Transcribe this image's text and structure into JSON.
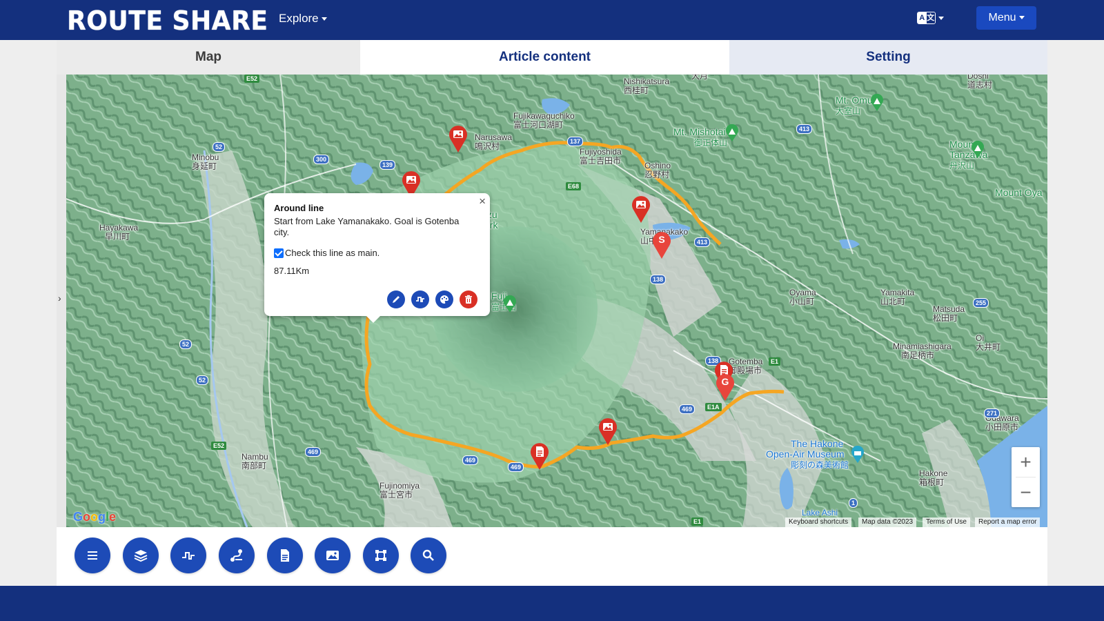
{
  "header": {
    "logo": "ROUTE SHARE",
    "explore_label": "Explore",
    "lang_a": "A",
    "lang_b": "文",
    "menu_label": "Menu"
  },
  "tabs": [
    {
      "label": "Map"
    },
    {
      "label": "Article content"
    },
    {
      "label": "Setting"
    }
  ],
  "popup": {
    "title": "Around line",
    "description": "Start from Lake Yamanakako. Goal is Gotenba city.",
    "checkbox_label": "Check this line as main.",
    "checked": true,
    "distance": "87.11Km",
    "close_label": "×"
  },
  "map": {
    "labels": {
      "nishikatsura": "Nishikatsura",
      "nishikatsura_jp": "西桂町",
      "otsuki_jp": "大月",
      "doshi": "Doshi",
      "doshi_jp": "道志村",
      "mt_omuro": "Mt. Omuro",
      "mt_omuro_jp": "大室山",
      "fujikawaguchiko": "Fujikawaguchiko",
      "fujikawaguchiko_jp": "富士河口湖町",
      "narusawa": "Narusawa",
      "narusawa_jp": "鳴沢村",
      "fujiyoshida": "Fujiyoshida",
      "fujiyoshida_jp": "富士吉田市",
      "oshino": "Oshino",
      "oshino_jp": "忍野村",
      "mt_mishotai": "Mt. Mishotai",
      "mt_mishotai_jp": "御正体山",
      "mount_tanzawa": "Mount",
      "mount_tanzawa2": "Tanzawa",
      "mount_tanzawa_jp": "丹沢山",
      "mount_oyama": "Mount Oya",
      "minobu": "Minobu",
      "minobu_jp": "身延町",
      "hayakawa": "Hayakawa",
      "hayakawa_jp": "早川町",
      "yamanakako": "Yamanakako",
      "yamanakako_jp": "山中",
      "izu": "Izu",
      "park": "ark",
      "fuji": "Fuji",
      "fuji_jp": "富士山",
      "oyama": "Oyama",
      "oyama_jp": "小山町",
      "yamakita": "Yamakita",
      "yamakita_jp": "山北町",
      "matsuda": "Matsuda",
      "matsuda_jp": "松田町",
      "minamiashigara": "Minamiashigara",
      "minamiashigara_jp": "南足柄市",
      "oi": "Oi",
      "oi_jp": "大井町",
      "gotemba": "Gotemba",
      "gotemba_jp": "御殿場市",
      "odawara": "Odawara",
      "odawara_jp": "小田原市",
      "hakone_museum": "The Hakone",
      "hakone_museum2": "Open-Air Museum",
      "hakone_museum_jp": "彫刻の森美術館",
      "hakone": "Hakone",
      "hakone_jp": "箱根町",
      "lake_ashi": "Lake Ashi",
      "nambu": "Nambu",
      "nambu_jp": "南部町",
      "fujinomiya": "Fujinomiya",
      "fujinomiya_jp": "富士宮市"
    },
    "shields": {
      "r52a": "52",
      "r52b": "52",
      "r52c": "52",
      "r300": "300",
      "r139": "139",
      "r137": "137",
      "r413a": "413",
      "r413b": "413",
      "r138a": "138",
      "r138b": "138",
      "r255": "255",
      "r271": "271",
      "r469a": "469",
      "r469b": "469",
      "r469c": "469",
      "r469d": "469",
      "e52a": "E52",
      "e52b": "E52",
      "e68": "E68",
      "e1": "E1",
      "e1a": "E1A",
      "e1b": "E1",
      "r1": "1"
    },
    "markers": {
      "start": "S",
      "goal": "G"
    },
    "zoom_in": "+",
    "zoom_out": "−",
    "google": "Google",
    "attribution": {
      "shortcuts": "Keyboard shortcuts",
      "data": "Map data ©2023",
      "terms": "Terms of Use",
      "report": "Report a map error"
    },
    "sidebar_toggle": "›"
  },
  "colors": {
    "navy": "#14307e",
    "accent": "#1d4bb7",
    "route": "#f5a623",
    "marker_red": "#d93025"
  },
  "toolbar": {
    "buttons": [
      "menu-icon",
      "layers-icon",
      "elevation-icon",
      "route-icon",
      "document-icon",
      "image-icon",
      "crop-icon",
      "search-icon"
    ]
  }
}
